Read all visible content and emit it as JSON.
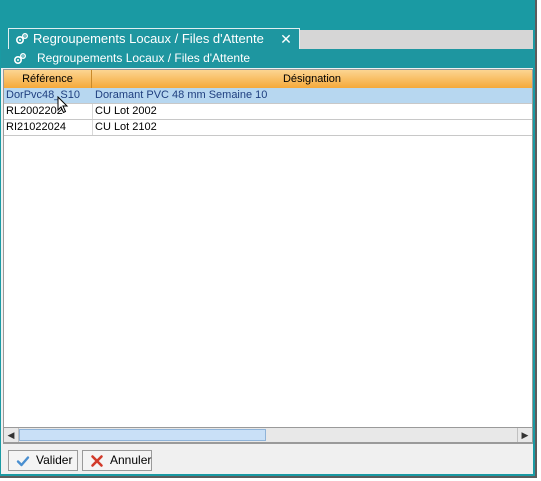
{
  "tab": {
    "title": "Regroupements Locaux / Files d'Attente",
    "close_glyph": "✕",
    "icon": "gears-icon"
  },
  "panel": {
    "title": "Regroupements Locaux / Files d'Attente",
    "icon": "gears-icon"
  },
  "grid": {
    "columns": [
      "Référence",
      "Désignation"
    ],
    "rows": [
      {
        "reference": "DorPvc48_S10",
        "designation": "Doramant PVC 48 mm Semaine 10",
        "selected": true
      },
      {
        "reference": "RL2002202",
        "designation": "CU Lot 2002",
        "selected": false
      },
      {
        "reference": "RI21022024",
        "designation": "CU Lot 2102",
        "selected": false
      }
    ]
  },
  "scrollbar": {
    "left_arrow": "◀",
    "right_arrow": "▶"
  },
  "footer": {
    "validate_label": "Valider",
    "cancel_label": "Annuler"
  },
  "colors": {
    "accent": "#1a9aa3",
    "header_orange": "#f5a93a",
    "selection": "#b7d7f0",
    "cancel_red": "#d23a2a",
    "validate_blue": "#4a8fd0"
  }
}
